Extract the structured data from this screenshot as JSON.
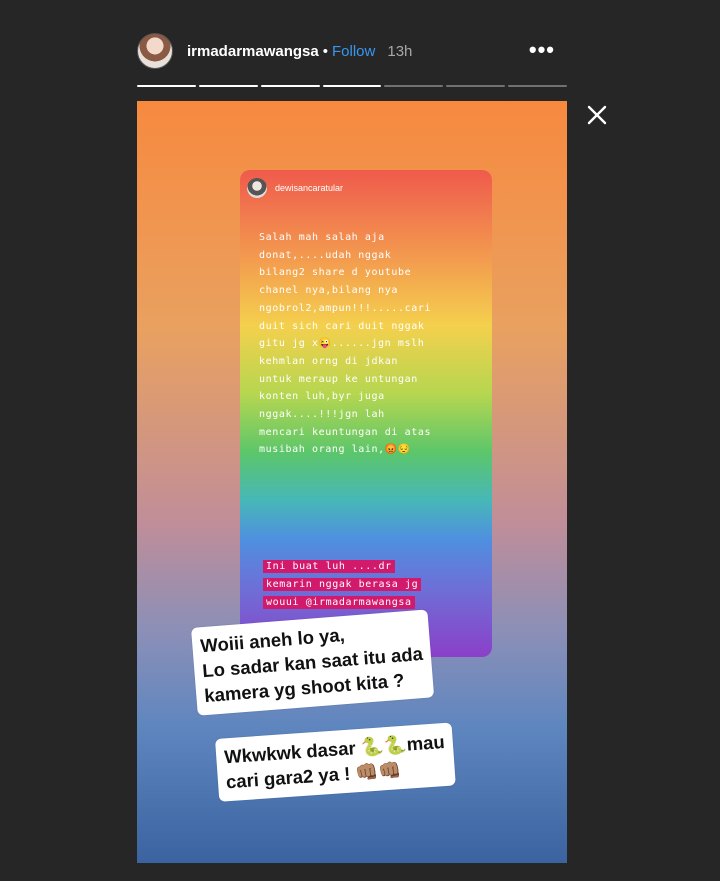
{
  "header": {
    "username": "irmadarmawangsa",
    "separator": "•",
    "follow_label": "Follow",
    "time": "13h",
    "more_icon": "more-horizontal-icon"
  },
  "progress": {
    "segments": [
      1,
      1,
      1,
      1,
      0,
      0,
      0
    ]
  },
  "controls": {
    "close_icon": "close-icon"
  },
  "repost": {
    "username": "dewisancaratular",
    "text": "Salah mah salah aja\ndonat,....udah nggak\nbilang2 share d youtube\nchanel nya,bilang nya\nngobrol2,ampun!!!.....cari\nduit sich cari duit nggak\ngitu jg x😜......jgn mslh\nkehmlan orng di jdkan\nuntuk meraup ke untungan\nkonten luh,byr juga\nnggak....!!!jgn lah\nmencari keuntungan di atas\nmusibah orang lain,😡😔",
    "highlight": "Ini buat luh ....dr\nkemarin nggak berasa jg\nwouui @irmadarmawangsa"
  },
  "stickers": {
    "first": "Woiii aneh lo ya,\nLo sadar kan saat itu ada\nkamera yg shoot kita ?",
    "second": "Wkwkwk dasar 🐍🐍mau\ncari gara2 ya ! 👊🏽👊🏽"
  }
}
